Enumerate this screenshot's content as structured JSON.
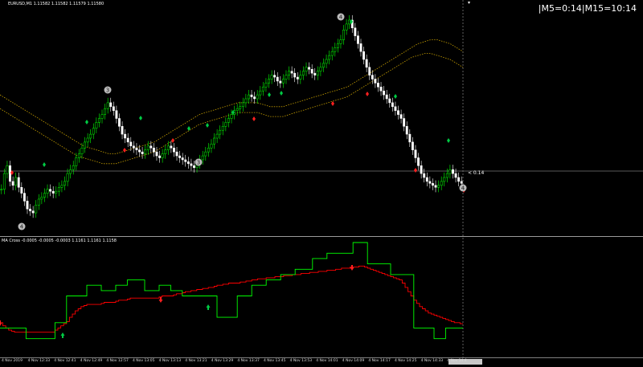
{
  "symbol_header": "EURUSD,M1  1.11582 1.11582 1.11579 1.11580",
  "timer_text": "|M5=0:14|M15=10:14",
  "price_line_label": "< 0.14",
  "indicator_header": "MA Cross -0.0005 -0.0005 -0.0003  1.1161 1.1161 1.1158",
  "markers": {
    "wave_labels": [
      "4",
      "3",
      "3",
      "4",
      "4"
    ]
  },
  "x_axis_ticks": [
    "4 Nov 2019",
    "4 Nov 12:33",
    "4 Nov 12:41",
    "4 Nov 12:49",
    "4 Nov 12:57",
    "4 Nov 13:05",
    "4 Nov 13:13",
    "4 Nov 13:21",
    "4 Nov 13:29",
    "4 Nov 13:37",
    "4 Nov 13:45",
    "4 Nov 13:53",
    "4 Nov 14:01",
    "4 Nov 14:09",
    "4 Nov 14:17",
    "4 Nov 14:25",
    "4 Nov 14:33",
    "4 Nov 14:4"
  ],
  "colors": {
    "bull": "#00ff00",
    "bear": "#ffffff",
    "ma_band": "#c8a000",
    "buy_diamond": "#00cc44",
    "sell_diamond": "#ff2020",
    "fast_line": "#00ff00",
    "slow_line": "#ff0000"
  },
  "chart_data": {
    "type": "candlestick",
    "closes": [
      14,
      22,
      26,
      18,
      16,
      20,
      15,
      12,
      8,
      4,
      3,
      2,
      6,
      9,
      10,
      12,
      14,
      13,
      12,
      13,
      15,
      16,
      18,
      22,
      24,
      26,
      30,
      32,
      35,
      38,
      40,
      42,
      45,
      48,
      50,
      52,
      55,
      58,
      56,
      54,
      50,
      46,
      42,
      40,
      38,
      36,
      35,
      34,
      33,
      32,
      34,
      36,
      35,
      33,
      31,
      30,
      32,
      34,
      36,
      35,
      33,
      31,
      30,
      29,
      28,
      27,
      26,
      25,
      27,
      29,
      31,
      33,
      35,
      37,
      40,
      42,
      44,
      46,
      48,
      50,
      52,
      54,
      55,
      56,
      58,
      60,
      62,
      61,
      60,
      62,
      64,
      66,
      68,
      70,
      72,
      71,
      69,
      68,
      70,
      72,
      74,
      73,
      71,
      70,
      72,
      74,
      76,
      75,
      73,
      72,
      74,
      76,
      78,
      80,
      82,
      84,
      86,
      88,
      90,
      95,
      98,
      100,
      96,
      92,
      88,
      84,
      80,
      76,
      72,
      70,
      68,
      66,
      64,
      62,
      60,
      58,
      56,
      54,
      52,
      50,
      46,
      42,
      38,
      34,
      30,
      26,
      22,
      20,
      18,
      17,
      16,
      15,
      16,
      18,
      20,
      22,
      24,
      22,
      20,
      18,
      17
    ],
    "band_upper": [
      62,
      60,
      58,
      56,
      54,
      52,
      50,
      48,
      46,
      44,
      42,
      40,
      38,
      36,
      35,
      34,
      33,
      32,
      32,
      33,
      34,
      35,
      36,
      37,
      38,
      40,
      42,
      44,
      46,
      48,
      50,
      52,
      53,
      54,
      55,
      56,
      57,
      58,
      58,
      58,
      58,
      57,
      56,
      56,
      56,
      57,
      58,
      59,
      60,
      61,
      62,
      63,
      64,
      65,
      66,
      68,
      70,
      72,
      74,
      76,
      78,
      80,
      82,
      84,
      86,
      88,
      89,
      90,
      90,
      89,
      88,
      86,
      84
    ],
    "band_lower": [
      55,
      53,
      51,
      49,
      47,
      45,
      43,
      41,
      39,
      37,
      35,
      33,
      31,
      30,
      29,
      28,
      27,
      27,
      27,
      28,
      29,
      30,
      31,
      32,
      33,
      35,
      37,
      39,
      41,
      43,
      45,
      47,
      48,
      49,
      50,
      51,
      52,
      53,
      53,
      53,
      53,
      52,
      51,
      51,
      51,
      52,
      53,
      54,
      55,
      56,
      57,
      58,
      59,
      60,
      61,
      63,
      65,
      67,
      69,
      71,
      73,
      75,
      77,
      79,
      81,
      82,
      83,
      83,
      82,
      81,
      80,
      78,
      76
    ],
    "fast_line": [
      0.2,
      0.2,
      0.2,
      0.2,
      0.2,
      0.2,
      0.2,
      0.2,
      0.2,
      0.1,
      0.1,
      0.1,
      0.1,
      0.1,
      0.1,
      0.1,
      0.1,
      0.1,
      0.1,
      0.25,
      0.25,
      0.25,
      0.25,
      0.5,
      0.5,
      0.5,
      0.5,
      0.5,
      0.5,
      0.5,
      0.6,
      0.6,
      0.6,
      0.6,
      0.6,
      0.55,
      0.55,
      0.55,
      0.55,
      0.55,
      0.6,
      0.6,
      0.6,
      0.6,
      0.65,
      0.65,
      0.65,
      0.65,
      0.65,
      0.65,
      0.55,
      0.55,
      0.55,
      0.55,
      0.55,
      0.6,
      0.6,
      0.6,
      0.6,
      0.55,
      0.55,
      0.55,
      0.55,
      0.5,
      0.5,
      0.5,
      0.5,
      0.5,
      0.5,
      0.5,
      0.5,
      0.5,
      0.5,
      0.5,
      0.5,
      0.3,
      0.3,
      0.3,
      0.3,
      0.3,
      0.3,
      0.3,
      0.5,
      0.5,
      0.5,
      0.5,
      0.5,
      0.6,
      0.6,
      0.6,
      0.6,
      0.6,
      0.65,
      0.65,
      0.65,
      0.65,
      0.65,
      0.7,
      0.7,
      0.7,
      0.7,
      0.7,
      0.75,
      0.75,
      0.75,
      0.75,
      0.75,
      0.75,
      0.85,
      0.85,
      0.85,
      0.85,
      0.85,
      0.9,
      0.9,
      0.9,
      0.9,
      0.9,
      0.9,
      0.9,
      0.9,
      0.9,
      1.0,
      1.0,
      1.0,
      1.0,
      1.0,
      0.8,
      0.8,
      0.8,
      0.8,
      0.8,
      0.8,
      0.8,
      0.8,
      0.7,
      0.7,
      0.7,
      0.7,
      0.7,
      0.7,
      0.7,
      0.7,
      0.2,
      0.2,
      0.2,
      0.2,
      0.2,
      0.2,
      0.2,
      0.1,
      0.1,
      0.1,
      0.1,
      0.2,
      0.2,
      0.2,
      0.2,
      0.2,
      0.2,
      0.2
    ],
    "slow_line": [
      0.25,
      0.22,
      0.2,
      0.18,
      0.17,
      0.16,
      0.16,
      0.16,
      0.16,
      0.16,
      0.16,
      0.16,
      0.16,
      0.16,
      0.16,
      0.16,
      0.16,
      0.16,
      0.16,
      0.18,
      0.2,
      0.22,
      0.24,
      0.26,
      0.3,
      0.33,
      0.36,
      0.38,
      0.4,
      0.41,
      0.42,
      0.42,
      0.42,
      0.42,
      0.42,
      0.43,
      0.44,
      0.44,
      0.44,
      0.44,
      0.45,
      0.46,
      0.46,
      0.46,
      0.47,
      0.48,
      0.48,
      0.48,
      0.48,
      0.48,
      0.48,
      0.48,
      0.48,
      0.48,
      0.48,
      0.49,
      0.5,
      0.5,
      0.5,
      0.5,
      0.51,
      0.52,
      0.52,
      0.53,
      0.54,
      0.54,
      0.55,
      0.55,
      0.56,
      0.56,
      0.57,
      0.57,
      0.58,
      0.58,
      0.59,
      0.6,
      0.6,
      0.61,
      0.61,
      0.62,
      0.62,
      0.62,
      0.62,
      0.63,
      0.63,
      0.64,
      0.64,
      0.65,
      0.65,
      0.66,
      0.66,
      0.66,
      0.67,
      0.67,
      0.67,
      0.68,
      0.68,
      0.68,
      0.69,
      0.69,
      0.69,
      0.7,
      0.7,
      0.7,
      0.71,
      0.71,
      0.71,
      0.72,
      0.72,
      0.72,
      0.73,
      0.73,
      0.73,
      0.74,
      0.74,
      0.74,
      0.75,
      0.75,
      0.76,
      0.76,
      0.76,
      0.77,
      0.77,
      0.77,
      0.78,
      0.78,
      0.77,
      0.76,
      0.75,
      0.74,
      0.73,
      0.72,
      0.71,
      0.7,
      0.69,
      0.68,
      0.67,
      0.66,
      0.65,
      0.62,
      0.58,
      0.54,
      0.5,
      0.46,
      0.43,
      0.4,
      0.38,
      0.36,
      0.34,
      0.33,
      0.32,
      0.31,
      0.3,
      0.29,
      0.28,
      0.27,
      0.26,
      0.25,
      0.25,
      0.24,
      0.24
    ]
  }
}
